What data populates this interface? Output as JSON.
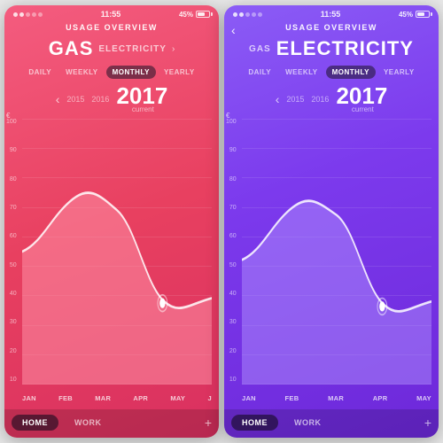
{
  "phones": [
    {
      "id": "gas",
      "type": "gas",
      "status": {
        "dots": [
          true,
          true,
          false,
          false,
          false
        ],
        "time": "11:55",
        "battery": "45%"
      },
      "header": "USAGE OVERVIEW",
      "titleMain": "GAS",
      "titleSecondary": "ELECTRICITY",
      "showBack": false,
      "periods": [
        "DAILY",
        "WEEKLY",
        "MONTHLY",
        "YEARLY"
      ],
      "activePeriod": "MONTHLY",
      "years": [
        "2015",
        "2016"
      ],
      "currentYear": "2017",
      "currentLabel": "current",
      "yLabels": [
        "100",
        "90",
        "80",
        "70",
        "60",
        "50",
        "40",
        "30",
        "20",
        "10"
      ],
      "euroSymbol": "€",
      "xLabels": [
        "JAN",
        "FEB",
        "MAR",
        "APR",
        "MAY",
        "J"
      ],
      "chartColor": "rgba(255,150,170,0.55)",
      "chartStroke": "rgba(255,255,255,0.85)",
      "dotColor": "rgba(255,255,255,0.9)",
      "bottomTabs": [
        "HOME",
        "WORK"
      ],
      "activeBottomTab": "HOME"
    },
    {
      "id": "electricity",
      "type": "electricity",
      "status": {
        "dots": [
          true,
          true,
          false,
          false,
          false
        ],
        "time": "11:55",
        "battery": "45%"
      },
      "header": "USAGE OVERVIEW",
      "titleMain": "ELECTRICITY",
      "titleSecondary": "GAS",
      "showBack": true,
      "periods": [
        "DAILY",
        "WEEKLY",
        "MONTHLY",
        "YEARLY"
      ],
      "activePeriod": "MONTHLY",
      "years": [
        "2015",
        "2016"
      ],
      "currentYear": "2017",
      "currentLabel": "current",
      "yLabels": [
        "100",
        "90",
        "80",
        "70",
        "60",
        "50",
        "40",
        "30",
        "20",
        "10"
      ],
      "euroSymbol": "€",
      "xLabels": [
        "JAN",
        "FEB",
        "MAR",
        "APR",
        "MAY"
      ],
      "chartColor": "rgba(180,150,255,0.45)",
      "chartStroke": "rgba(255,255,255,0.85)",
      "dotColor": "rgba(255,255,255,0.9)",
      "bottomTabs": [
        "HOME",
        "WORK"
      ],
      "activeBottomTab": "HOME"
    }
  ]
}
